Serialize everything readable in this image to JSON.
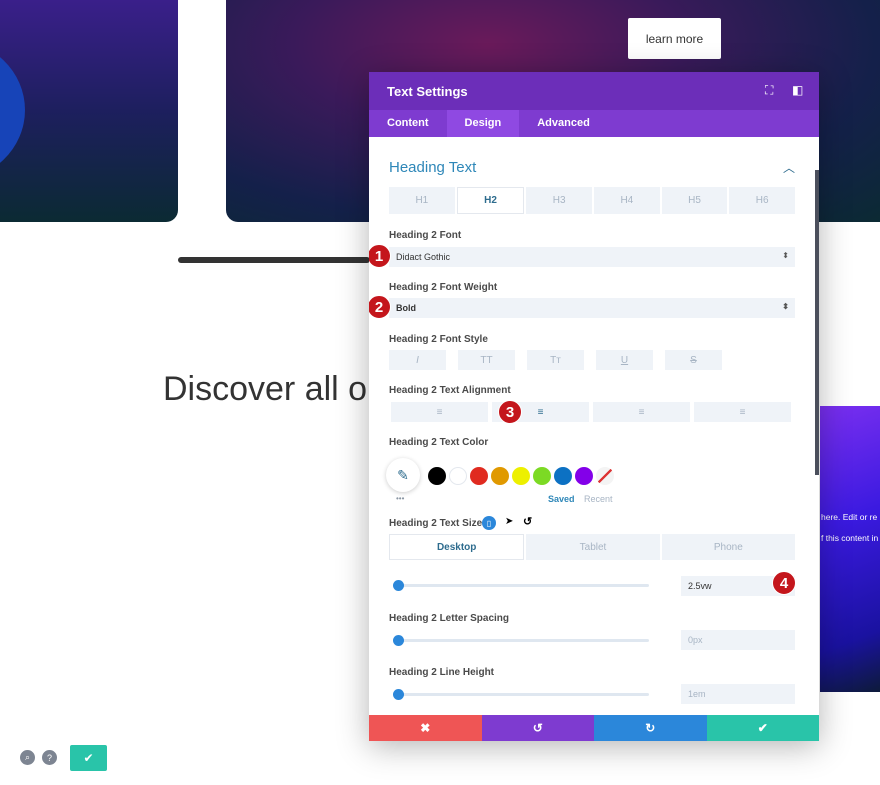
{
  "page": {
    "learn_more": "learn more",
    "discover_heading": "Discover all ou",
    "right_card_line1": "here. Edit or re",
    "right_card_line2": "f this content in"
  },
  "modal": {
    "title": "Text Settings",
    "tabs": [
      "Content",
      "Design",
      "Advanced"
    ],
    "active_tab": "Design",
    "section_title": "Heading Text",
    "heading_tabs": [
      "H1",
      "H2",
      "H3",
      "H4",
      "H5",
      "H6"
    ],
    "font_label": "Heading 2 Font",
    "font_value": "Didact Gothic",
    "weight_label": "Heading 2 Font Weight",
    "weight_value": "Bold",
    "style_label": "Heading 2 Font Style",
    "style_buttons": [
      "I",
      "TT",
      "Tт",
      "U",
      "S"
    ],
    "align_label": "Heading 2 Text Alignment",
    "color_label": "Heading 2 Text Color",
    "swatches": [
      "#000000",
      "#ffffff",
      "#e02b20",
      "#e09900",
      "#edf000",
      "#7cda24",
      "#0c71c3",
      "#8300e9"
    ],
    "saved": "Saved",
    "recent": "Recent",
    "more": "•••",
    "size_label": "Heading 2 Text Size",
    "device_tabs": [
      "Desktop",
      "Tablet",
      "Phone"
    ],
    "size_value": "2.5vw",
    "spacing_label": "Heading 2 Letter Spacing",
    "spacing_placeholder": "0px",
    "lineheight_label": "Heading 2 Line Height",
    "lineheight_placeholder": "1em"
  },
  "badges": [
    "1",
    "2",
    "3",
    "4"
  ],
  "colors": {
    "header": "#6c2eb9",
    "tabs": "#7e3bd0",
    "cancel": "#ef5555",
    "undo": "#7e3bd0",
    "redo": "#2b87da",
    "save": "#29c4a9",
    "badge": "#c4161c"
  }
}
